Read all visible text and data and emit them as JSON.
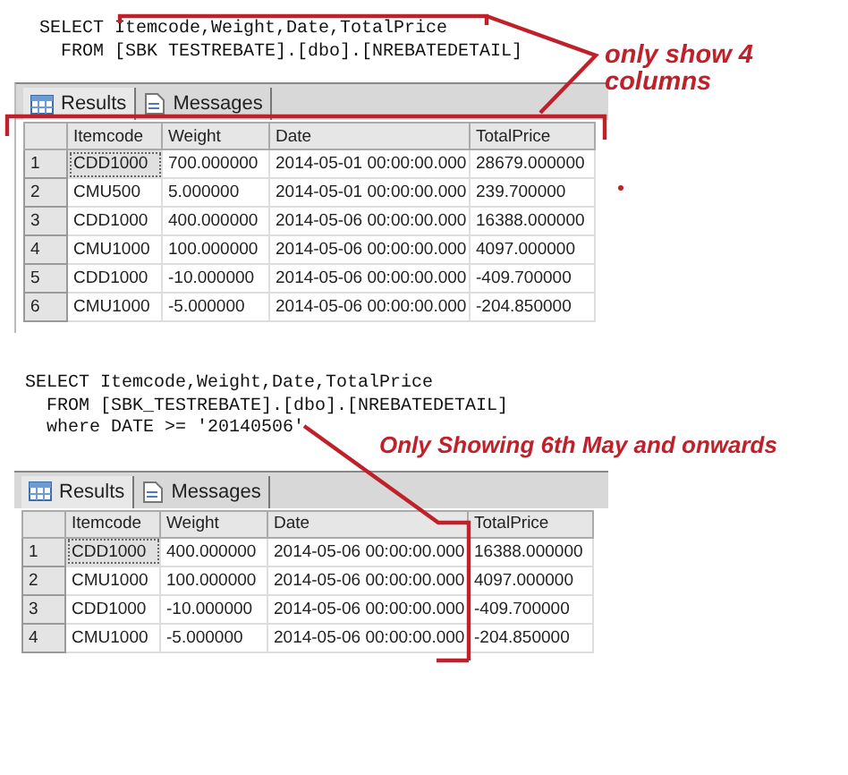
{
  "sections": [
    {
      "query": [
        "SELECT Itemcode,Weight,Date,TotalPrice",
        "  FROM [SBK TESTREBATE].[dbo].[NREBATEDETAIL]"
      ],
      "note": "only show 4 columns",
      "tabs": [
        {
          "label": "Results",
          "selected": true
        },
        {
          "label": "Messages",
          "selected": false
        }
      ],
      "columns": [
        "Itemcode",
        "Weight",
        "Date",
        "TotalPrice"
      ],
      "rows": [
        {
          "number": "1",
          "selected": true,
          "cells": [
            "CDD1000",
            "700.000000",
            "2014-05-01 00:00:00.000",
            "28679.000000"
          ]
        },
        {
          "number": "2",
          "selected": false,
          "cells": [
            "CMU500",
            "5.000000",
            "2014-05-01 00:00:00.000",
            "239.700000"
          ]
        },
        {
          "number": "3",
          "selected": false,
          "cells": [
            "CDD1000",
            "400.000000",
            "2014-05-06 00:00:00.000",
            "16388.000000"
          ]
        },
        {
          "number": "4",
          "selected": false,
          "cells": [
            "CMU1000",
            "100.000000",
            "2014-05-06 00:00:00.000",
            "4097.000000"
          ]
        },
        {
          "number": "5",
          "selected": false,
          "cells": [
            "CDD1000",
            "-10.000000",
            "2014-05-06 00:00:00.000",
            "-409.700000"
          ]
        },
        {
          "number": "6",
          "selected": false,
          "cells": [
            "CMU1000",
            "-5.000000",
            "2014-05-06 00:00:00.000",
            "-204.850000"
          ]
        }
      ]
    },
    {
      "query": [
        "SELECT Itemcode,Weight,Date,TotalPrice",
        "  FROM [SBK_TESTREBATE].[dbo].[NREBATEDETAIL]",
        "  where DATE >= '20140506'"
      ],
      "note": "Only Showing 6th May and onwards",
      "tabs": [
        {
          "label": "Results",
          "selected": true
        },
        {
          "label": "Messages",
          "selected": false
        }
      ],
      "columns": [
        "Itemcode",
        "Weight",
        "Date",
        "TotalPrice"
      ],
      "rows": [
        {
          "number": "1",
          "selected": true,
          "cells": [
            "CDD1000",
            "400.000000",
            "2014-05-06 00:00:00.000",
            "16388.000000"
          ]
        },
        {
          "number": "2",
          "selected": false,
          "cells": [
            "CMU1000",
            "100.000000",
            "2014-05-06 00:00:00.000",
            "4097.000000"
          ]
        },
        {
          "number": "3",
          "selected": false,
          "cells": [
            "CDD1000",
            "-10.000000",
            "2014-05-06 00:00:00.000",
            "-409.700000"
          ]
        },
        {
          "number": "4",
          "selected": false,
          "cells": [
            "CMU1000",
            "-5.000000",
            "2014-05-06 00:00:00.000",
            "-204.850000"
          ]
        }
      ]
    }
  ]
}
